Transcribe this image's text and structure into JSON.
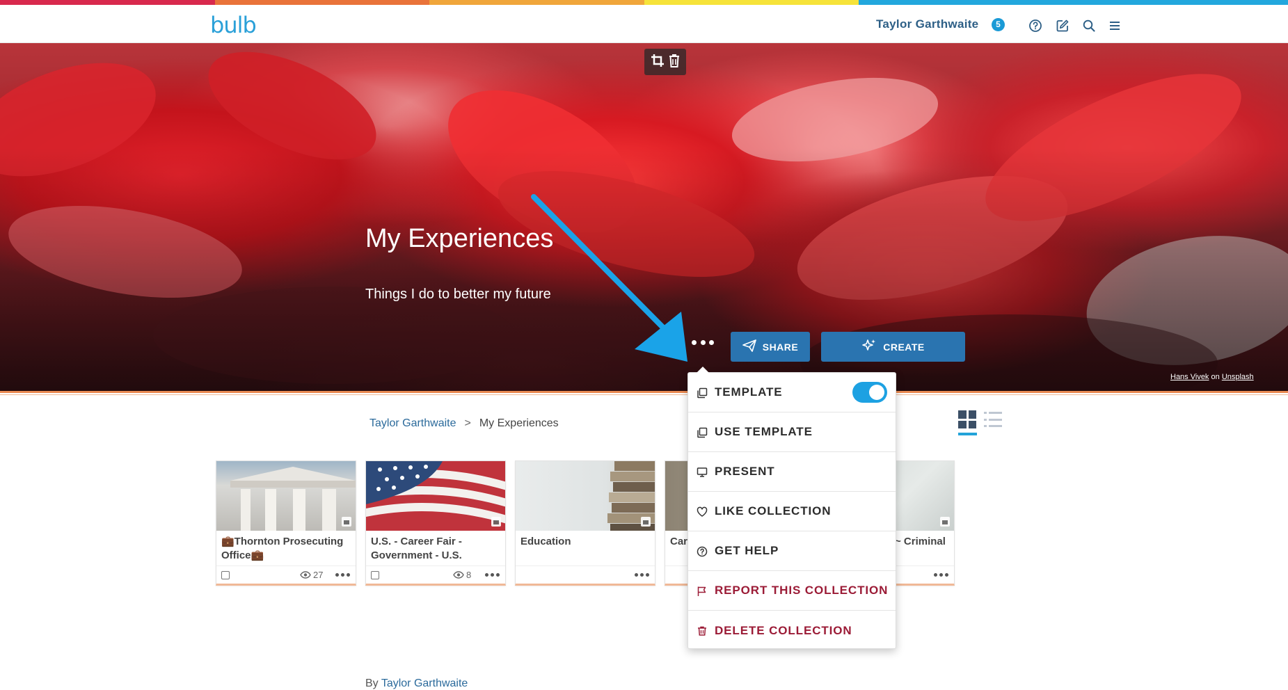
{
  "header": {
    "logo": "bulb",
    "user_name": "Taylor Garthwaite",
    "notification_count": "5",
    "rainbow_colors": [
      "#d8294d",
      "#e9733a",
      "#f0a63b",
      "#f6e33a",
      "#22a7dd",
      "#22a7dd"
    ]
  },
  "hero": {
    "title": "My Experiences",
    "subtitle": "Things I do to better my future",
    "share_label": "SHARE",
    "create_label": "CREATE",
    "credit_author": "Hans Vivek",
    "credit_on": "on",
    "credit_source": "Unsplash"
  },
  "breadcrumb": {
    "parent": "Taylor Garthwaite",
    "separator": ">",
    "current": "My Experiences"
  },
  "cards": [
    {
      "title": "💼Thornton Prosecuting Office💼",
      "views": "27",
      "thumb": "building"
    },
    {
      "title": "U.S. - Career Fair - Government - U.S.",
      "views": "8",
      "thumb": "flag"
    },
    {
      "title": "Education",
      "views": "",
      "thumb": "books"
    },
    {
      "title": "Car",
      "views": "",
      "thumb": "mixed"
    },
    {
      "title": "~ Criminal",
      "views": "",
      "thumb": "paper"
    }
  ],
  "menu": {
    "items": [
      {
        "label": "TEMPLATE",
        "icon": "copy-icon",
        "toggle_on": true
      },
      {
        "label": "USE TEMPLATE",
        "icon": "copy-icon"
      },
      {
        "label": "PRESENT",
        "icon": "monitor-icon"
      },
      {
        "label": "LIKE COLLECTION",
        "icon": "heart-icon"
      },
      {
        "label": "GET HELP",
        "icon": "help-icon"
      },
      {
        "label": "REPORT THIS COLLECTION",
        "icon": "flag-icon",
        "danger": true
      },
      {
        "label": "DELETE COLLECTION",
        "icon": "trash-icon",
        "danger": true
      }
    ]
  },
  "footer": {
    "by": "By",
    "author": "Taylor Garthwaite"
  },
  "colors": {
    "accent": "#2a74b0",
    "link": "#2b6a9b",
    "toggle": "#1da1e2",
    "danger": "#9b1b36",
    "annotation_arrow": "#1aa3e8"
  }
}
